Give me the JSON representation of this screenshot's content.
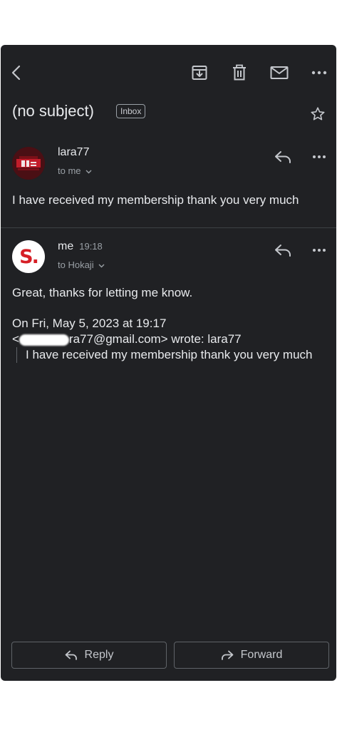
{
  "subject": "(no subject)",
  "label": "Inbox",
  "messages": [
    {
      "sender": "lara77",
      "recipient_line": "to me",
      "body": "I have received my membership thank you very much"
    },
    {
      "sender": "me",
      "time": "19:18",
      "recipient_line": "to Hokaji",
      "body": "Great, thanks for letting me know.",
      "quote_header_line1": "On Fri, May 5, 2023 at 19:17",
      "quote_header_line2_prefix": "<",
      "quote_header_line2_suffix": "ra77@gmail.com> wrote: lara77",
      "quoted_text": "I have received my membership thank you very much",
      "avatar_letter": "S."
    }
  ],
  "buttons": {
    "reply": "Reply",
    "forward": "Forward"
  },
  "colors": {
    "background": "#202124",
    "text": "#e8eaed",
    "muted": "#9aa0a6",
    "avatar_me": "#d61f26"
  }
}
